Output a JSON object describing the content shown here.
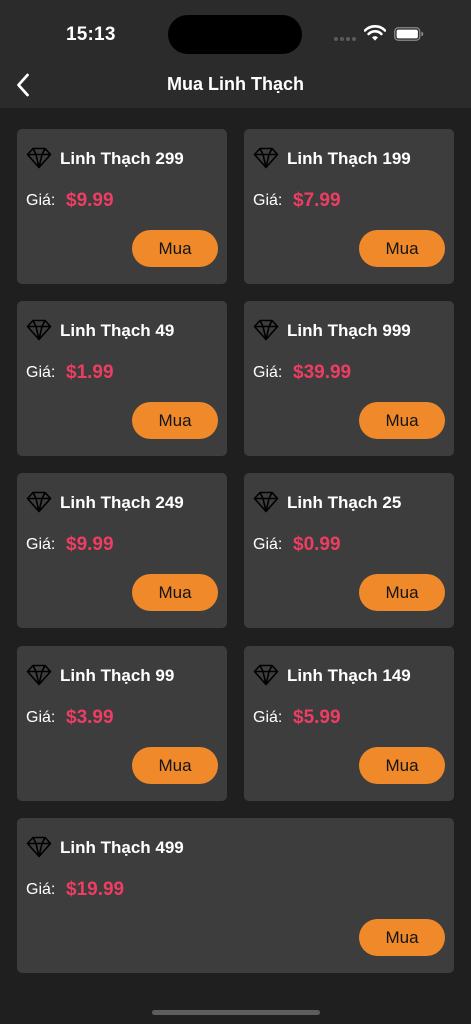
{
  "status": {
    "time": "15:13"
  },
  "nav": {
    "title": "Mua Linh Thạch",
    "back_icon": "chevron-left-icon"
  },
  "colors": {
    "accent": "#f0892a",
    "price": "#ee3d63",
    "card": "#3d3d3d",
    "background": "#1f1f1f"
  },
  "products": [
    {
      "name": "Linh Thạch 299",
      "price_label": "Giá:",
      "price": "$9.99",
      "buy_label": "Mua"
    },
    {
      "name": "Linh Thạch 199",
      "price_label": "Giá:",
      "price": "$7.99",
      "buy_label": "Mua"
    },
    {
      "name": "Linh Thạch 49",
      "price_label": "Giá:",
      "price": "$1.99",
      "buy_label": "Mua"
    },
    {
      "name": "Linh Thạch 999",
      "price_label": "Giá:",
      "price": "$39.99",
      "buy_label": "Mua"
    },
    {
      "name": "Linh Thạch 249",
      "price_label": "Giá:",
      "price": "$9.99",
      "buy_label": "Mua"
    },
    {
      "name": "Linh Thạch 25",
      "price_label": "Giá:",
      "price": "$0.99",
      "buy_label": "Mua"
    },
    {
      "name": "Linh Thạch 99",
      "price_label": "Giá:",
      "price": "$3.99",
      "buy_label": "Mua"
    },
    {
      "name": "Linh Thạch 149",
      "price_label": "Giá:",
      "price": "$5.99",
      "buy_label": "Mua"
    },
    {
      "name": "Linh Thạch 499",
      "price_label": "Giá:",
      "price": "$19.99",
      "buy_label": "Mua"
    }
  ]
}
